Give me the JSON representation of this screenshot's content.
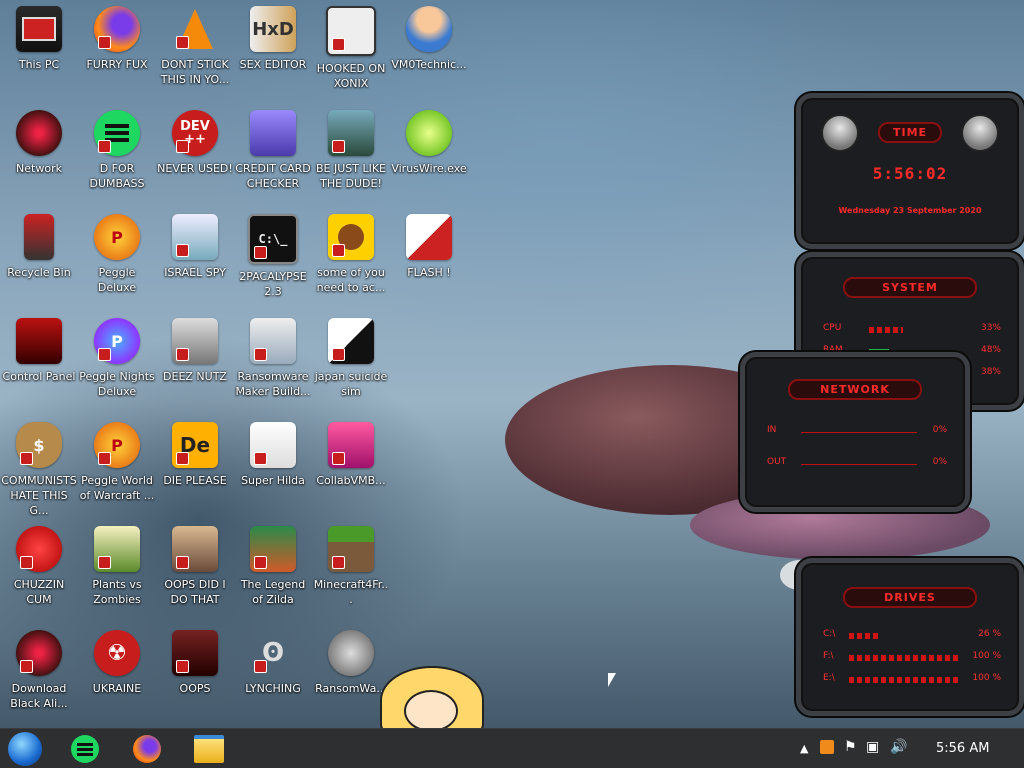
{
  "desktop": {
    "icons": [
      {
        "label": "This PC"
      },
      {
        "label": "FURRY FUX"
      },
      {
        "label": "DONT STICK THIS IN YO..."
      },
      {
        "label": "SEX EDITOR"
      },
      {
        "label": "HOOKED ON XONIX"
      },
      {
        "label": "VM0Technic..."
      },
      {
        "label": "Network"
      },
      {
        "label": "D FOR DUMBASS"
      },
      {
        "label": "NEVER USED!"
      },
      {
        "label": "CREDIT CARD CHECKER"
      },
      {
        "label": "BE JUST LIKE THE DUDE!"
      },
      {
        "label": "VirusWire.exe"
      },
      {
        "label": "Recycle Bin"
      },
      {
        "label": "Peggle Deluxe"
      },
      {
        "label": "ISRAEL SPY"
      },
      {
        "label": "2PACALYPSE 2.3"
      },
      {
        "label": "some of you need to ac..."
      },
      {
        "label": "FLASH !"
      },
      {
        "label": "Control Panel"
      },
      {
        "label": "Peggle Nights Deluxe"
      },
      {
        "label": "DEEZ NUTZ"
      },
      {
        "label": "Ransomware Maker Build..."
      },
      {
        "label": "japan suicide sim"
      },
      {
        "label": "COMMUNISTS HATE THIS G..."
      },
      {
        "label": "Peggle World of Warcraft ..."
      },
      {
        "label": "DIE PLEASE"
      },
      {
        "label": "Super Hilda"
      },
      {
        "label": "CollabVMB..."
      },
      {
        "label": "CHUZZIN CUM"
      },
      {
        "label": "Plants vs Zombies"
      },
      {
        "label": "OOPS DID I DO THAT"
      },
      {
        "label": "The Legend of Zilda"
      },
      {
        "label": "Minecraft4Fr..."
      },
      {
        "label": "Download Black Ali..."
      },
      {
        "label": "UKRAINE"
      },
      {
        "label": "OOPS"
      },
      {
        "label": "LYNCHING"
      },
      {
        "label": "RansomWa..."
      }
    ],
    "icon_glyphs": {
      "dev": "DEV",
      "dev_sub": "++",
      "de": "De",
      "p": "P",
      "cmd": "C:\\_"
    }
  },
  "widgets": {
    "time": {
      "title": "TIME",
      "clock": "5:56:02",
      "date": "Wednesday 23 September 2020"
    },
    "system": {
      "title": "SYSTEM",
      "rows": [
        {
          "label": "CPU",
          "value": "33%",
          "fill": 0.33
        },
        {
          "label": "RAM",
          "value": "48%",
          "fill": 0.48
        },
        {
          "label": "",
          "value": "38%",
          "fill": 0.38
        }
      ]
    },
    "network": {
      "title": "NETWORK",
      "rows": [
        {
          "label": "IN",
          "value": "0%"
        },
        {
          "label": "OUT",
          "value": "0%"
        }
      ]
    },
    "drives": {
      "title": "DRIVES",
      "rows": [
        {
          "label": "C:\\",
          "value": "26 %",
          "fill": 0.26
        },
        {
          "label": "F:\\",
          "value": "100 %",
          "fill": 1.0
        },
        {
          "label": "E:\\",
          "value": "100 %",
          "fill": 1.0
        }
      ]
    }
  },
  "taskbar": {
    "clock": "5:56 AM"
  },
  "colors": {
    "taskbar": "#2d2f31",
    "widget_accent": "#ff2a2a"
  }
}
